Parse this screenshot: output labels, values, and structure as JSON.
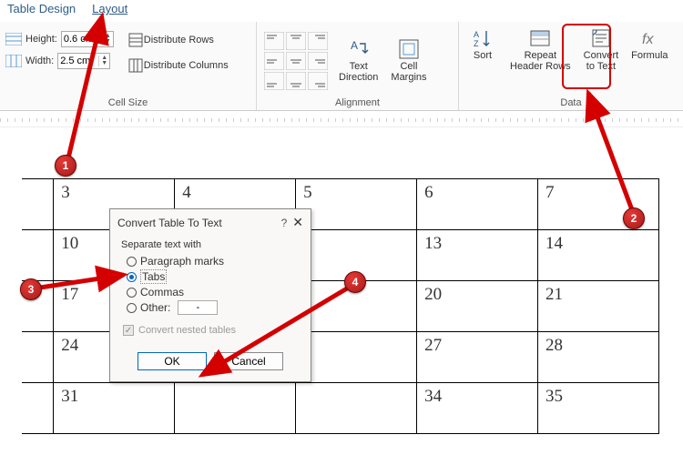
{
  "tabs": {
    "design": "Table Design",
    "layout": "Layout"
  },
  "ribbon": {
    "cellsize": {
      "label": "Cell Size",
      "height_label": "Height:",
      "height_value": "0.6 cm",
      "width_label": "Width:",
      "width_value": "2.5 cm",
      "dist_rows": "Distribute Rows",
      "dist_cols": "Distribute Columns"
    },
    "alignment": {
      "label": "Alignment",
      "text_direction": "Text\nDirection",
      "cell_margins": "Cell\nMargins"
    },
    "data": {
      "label": "Data",
      "sort": "Sort",
      "repeat": "Repeat\nHeader Rows",
      "convert": "Convert\nto Text",
      "formula": "Formula"
    }
  },
  "table": {
    "rows": [
      [
        "",
        "3",
        "4",
        "5",
        "6",
        "7"
      ],
      [
        "",
        "10",
        "",
        "",
        "13",
        "14"
      ],
      [
        "",
        "17",
        "",
        "",
        "20",
        "21"
      ],
      [
        "",
        "24",
        "",
        "",
        "27",
        "28"
      ],
      [
        "",
        "31",
        "",
        "",
        "34",
        "35"
      ]
    ]
  },
  "dialog": {
    "title": "Convert Table To Text",
    "help": "?",
    "close": "✕",
    "group_label": "Separate text with",
    "opt_para": "Paragraph marks",
    "opt_tabs": "Tabs",
    "opt_commas": "Commas",
    "opt_other": "Other:",
    "other_value": "-",
    "nested": "Convert nested tables",
    "ok": "OK",
    "cancel": "Cancel"
  },
  "annotations": {
    "b1": "1",
    "b2": "2",
    "b3": "3",
    "b4": "4"
  },
  "colors": {
    "accent": "#0067c0",
    "callout": "#d40000"
  }
}
